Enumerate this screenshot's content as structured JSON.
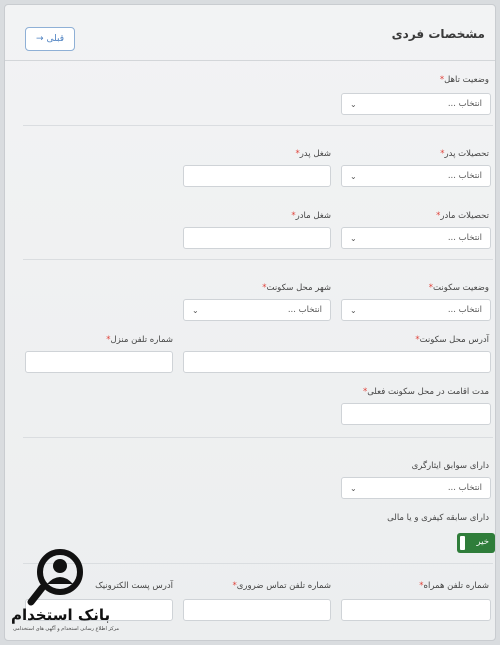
{
  "header": {
    "title": "مشخصات فردی",
    "back_label": "قبلی",
    "back_arrow": "→"
  },
  "select_placeholder": "انتخاب ...",
  "chevron": "⌄",
  "fields": {
    "marital_status": "وضعیت تاهل",
    "father_education": "تحصیلات پدر",
    "father_job": "شغل پدر",
    "mother_education": "تحصیلات مادر",
    "mother_job": "شغل مادر",
    "residence_status": "وضعیت سکونت",
    "residence_city": "شهر محل سکونت",
    "address": "آدرس محل سکونت",
    "home_phone": "شماره تلفن منزل",
    "residence_duration": "مدت اقامت در محل سکونت فعلی",
    "sacrifice_record": "دارای سوابق ایثارگری",
    "criminal_record": "دارای سابقه کیفری و یا مالی",
    "mobile": "شماره تلفن همراه",
    "emergency_phone": "شماره تلفن تماس ضروری",
    "email": "آدرس پست الکترونیک"
  },
  "required_mark": "*",
  "toggle": {
    "label": "خیر",
    "state": "off"
  },
  "watermark": {
    "name": "بانک استخدام",
    "sub": "مرکز اطلاع رسانی استخدام و آگهی های استخدامی"
  }
}
